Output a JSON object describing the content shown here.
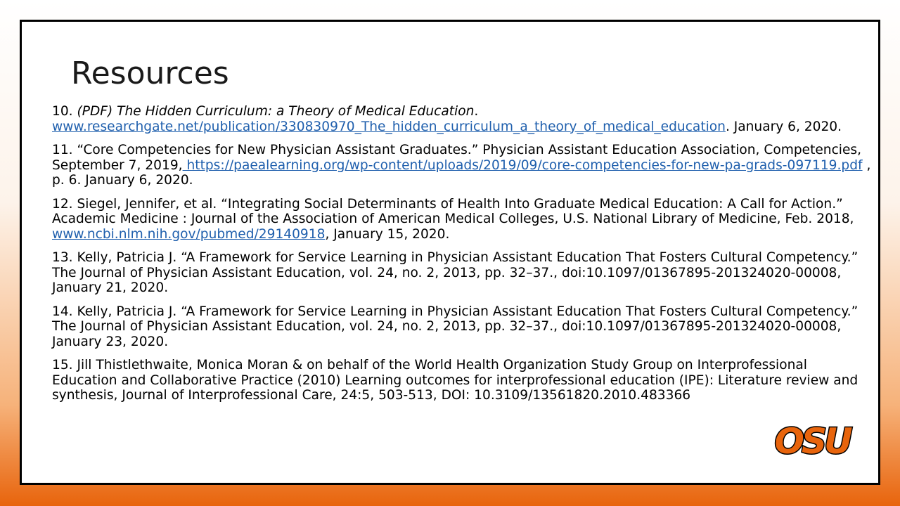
{
  "slide": {
    "title": "Resources",
    "references": [
      {
        "num": "10.",
        "title_italic": "(PDF) The Hidden Curriculum: a Theory of Medical Education",
        "after_title": ".",
        "link": "www.researchgate.net/publication/330830970_The_hidden_curriculum_a_theory_of_medical_education",
        "after_link": ".  January 6, 2020."
      },
      {
        "pre": "11. “Core Competencies for New Physician Assistant Graduates.” Physician Assistant Education Association, Competencies, September 7, 2019,",
        "link": " https://paealearning.org/wp-content/uploads/2019/09/core-competencies-for-new-pa-grads-097119.pdf",
        "after_link": " , p. 6. January 6, 2020."
      },
      {
        "pre": "12. Siegel, Jennifer, et al. “Integrating Social Determinants of Health Into Graduate Medical Education: A Call for Action.” Academic Medicine : Journal of the Association of American Medical Colleges, U.S. National Library of Medicine, Feb. 2018, ",
        "link": "www.ncbi.nlm.nih.gov/pubmed/29140918",
        "after_link": ", January 15, 2020."
      },
      {
        "text": "13. Kelly, Patricia J. “A Framework for Service Learning in Physician Assistant Education That Fosters Cultural Competency.” The Journal of Physician Assistant Education, vol. 24, no. 2, 2013, pp. 32–37., doi:10.1097/01367895-201324020-00008, January 21, 2020."
      },
      {
        "text": "14. Kelly, Patricia J. “A Framework for Service Learning in Physician Assistant Education That Fosters Cultural Competency.” The Journal of Physician Assistant Education, vol. 24, no. 2, 2013, pp. 32–37., doi:10.1097/01367895-201324020-00008, January 23, 2020."
      },
      {
        "text": "15. Jill Thistlethwaite, Monica Moran & on behalf of the World Health Organization Study Group on Interprofessional Education and Collaborative Practice (2010) Learning outcomes for interprofessional education (IPE): Literature review and synthesis, Journal of Interprofessional Care, 24:5, 503-513, DOI: 10.3109/13561820.2010.483366"
      }
    ],
    "logo": {
      "text": "OSU",
      "fill_color": "#e8640c",
      "outline_color": "#000000"
    },
    "colors": {
      "link": "#1f5fad",
      "accent_orange": "#e8640c",
      "border": "#000000"
    }
  }
}
